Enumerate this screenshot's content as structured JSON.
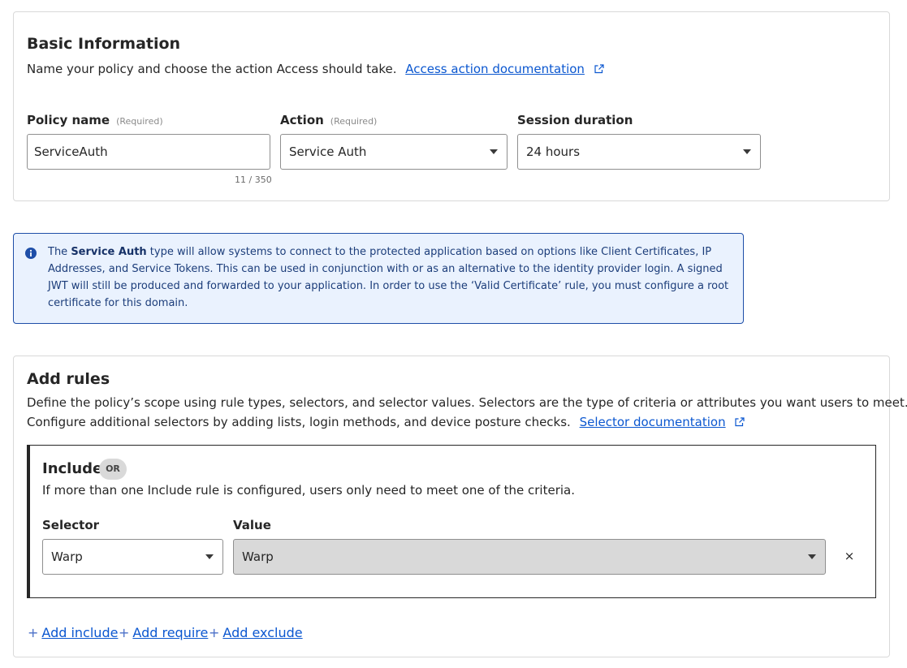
{
  "basic_info": {
    "title": "Basic Information",
    "description": "Name your policy and choose the action Access should take.",
    "doc_link": "Access action documentation",
    "fields": {
      "policy_name": {
        "label": "Policy name",
        "required": "(Required)",
        "value": "ServiceAuth",
        "counter": "11 / 350"
      },
      "action": {
        "label": "Action",
        "required": "(Required)",
        "value": "Service Auth"
      },
      "session": {
        "label": "Session duration",
        "value": "24 hours"
      }
    }
  },
  "info_banner": {
    "prefix": "The ",
    "bold": "Service Auth",
    "text": " type will allow systems to connect to the protected application based on options like Client Certificates, IP Addresses, and Service Tokens. This can be used in conjunction with or as an alternative to the identity provider login. A signed JWT will still be produced and forwarded to your application. In order to use the ‘Valid Certificate’ rule, you must configure a root certificate for this domain."
  },
  "add_rules": {
    "title": "Add rules",
    "description_line1": "Define the policy’s scope using rule types, selectors, and selector values. Selectors are the type of criteria or attributes you want users to meet.",
    "description_line2": "Configure additional selectors by adding lists, login methods, and device posture checks.",
    "doc_link": "Selector documentation",
    "include": {
      "title": "Include",
      "badge": "OR",
      "description": "If more than one Include rule is configured, users only need to meet one of the criteria.",
      "selector_label": "Selector",
      "value_label": "Value",
      "selector_value": "Warp",
      "value_value": "Warp",
      "remove_symbol": "×"
    },
    "actions": {
      "plus": "+",
      "add_include": "Add include",
      "add_require": "Add require",
      "add_exclude": "Add exclude"
    }
  },
  "icons": {
    "external_link": "external-link-icon",
    "info": "info-icon",
    "dropdown": "chevron-down-icon"
  },
  "colors": {
    "link": "#0b57d0",
    "info_bg": "#eaf2fe",
    "info_border": "#1e4ea8",
    "disabled_bg": "#d9d9d9"
  }
}
